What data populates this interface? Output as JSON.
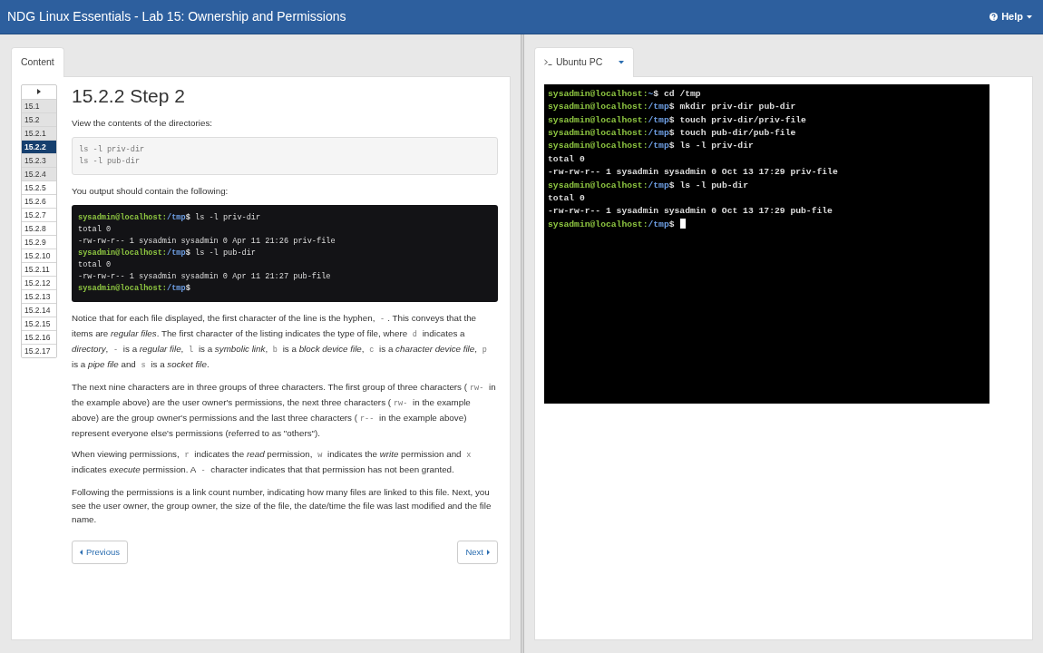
{
  "navbar": {
    "title": "NDG Linux Essentials - Lab 15: Ownership and Permissions",
    "help": "Help"
  },
  "left_tabs": [
    {
      "label": "Content",
      "selected": true
    }
  ],
  "step_nav": {
    "items": [
      {
        "label": "15.1",
        "selected": false,
        "visited": true
      },
      {
        "label": "15.2",
        "selected": false,
        "visited": true
      },
      {
        "label": "15.2.1",
        "selected": false,
        "visited": true
      },
      {
        "label": "15.2.2",
        "selected": true
      },
      {
        "label": "15.2.3",
        "selected": false,
        "visited": true
      },
      {
        "label": "15.2.4",
        "selected": false,
        "visited": true
      },
      {
        "label": "15.2.5",
        "selected": false,
        "visited": false
      },
      {
        "label": "15.2.6",
        "selected": false,
        "visited": false
      },
      {
        "label": "15.2.7",
        "selected": false,
        "visited": false
      },
      {
        "label": "15.2.8",
        "selected": false,
        "visited": false
      },
      {
        "label": "15.2.9",
        "selected": false,
        "visited": false
      },
      {
        "label": "15.2.10",
        "selected": false,
        "visited": false
      },
      {
        "label": "15.2.11",
        "selected": false,
        "visited": false
      },
      {
        "label": "15.2.12",
        "selected": false,
        "visited": false
      },
      {
        "label": "15.2.13",
        "selected": false,
        "visited": false
      },
      {
        "label": "15.2.14",
        "selected": false,
        "visited": false
      },
      {
        "label": "15.2.15",
        "selected": false,
        "visited": false
      },
      {
        "label": "15.2.16",
        "selected": false,
        "visited": false
      },
      {
        "label": "15.2.17",
        "selected": false,
        "visited": false
      }
    ]
  },
  "lesson": {
    "heading": "15.2.2 Step 2",
    "blocks": [
      {
        "kind": "paragraph",
        "segments": [
          {
            "kind": "text",
            "text": "View the contents of the directories:"
          }
        ]
      },
      {
        "kind": "command",
        "lines": [
          "ls -l priv-dir",
          "ls -l pub-dir"
        ]
      },
      {
        "kind": "paragraph",
        "segments": [
          {
            "kind": "text",
            "text": "You output should contain the following:"
          }
        ]
      },
      {
        "kind": "terminal",
        "lines": [
          {
            "kind": "prompt",
            "host": "sysadmin@localhost:",
            "path": "/tmp",
            "sign": "$",
            "command": " ls -l priv-dir"
          },
          {
            "kind": "output",
            "text": "total 0"
          },
          {
            "kind": "output",
            "text": "-rw-rw-r-- 1 sysadmin sysadmin 0 Apr 11 21:26 priv-file"
          },
          {
            "kind": "prompt",
            "host": "sysadmin@localhost:",
            "path": "/tmp",
            "sign": "$",
            "command": " ls -l pub-dir"
          },
          {
            "kind": "output",
            "text": "total 0"
          },
          {
            "kind": "output",
            "text": "-rw-rw-r-- 1 sysadmin sysadmin 0 Apr 11 21:27 pub-file"
          },
          {
            "kind": "prompt",
            "host": "sysadmin@localhost:",
            "path": "/tmp",
            "sign": "$"
          }
        ]
      },
      {
        "kind": "paragraph",
        "segments": [
          {
            "kind": "text",
            "text": "Notice that for each file displayed, the first character of the line is the hyphen, "
          },
          {
            "kind": "code",
            "text": "-"
          },
          {
            "kind": "text",
            "text": ". This conveys that the items are *regular files*. The first character of the listing indicates the type of file, where "
          },
          {
            "kind": "code",
            "text": "d"
          },
          {
            "kind": "text",
            "text": " indicates a *directory*, "
          },
          {
            "kind": "code",
            "text": "-"
          },
          {
            "kind": "text",
            "text": " is a *regular file*, "
          },
          {
            "kind": "code",
            "text": "l"
          },
          {
            "kind": "text",
            "text": " is a *symbolic link*, "
          },
          {
            "kind": "code",
            "text": "b"
          },
          {
            "kind": "text",
            "text": " is a *block device file*, "
          },
          {
            "kind": "code",
            "text": "c"
          },
          {
            "kind": "text",
            "text": " is a *character device file*, "
          },
          {
            "kind": "code",
            "text": "p"
          },
          {
            "kind": "text",
            "text": " is a *pipe file* and "
          },
          {
            "kind": "code",
            "text": "s"
          },
          {
            "kind": "text",
            "text": " is a *socket file*."
          }
        ]
      },
      {
        "kind": "paragraph",
        "segments": [
          {
            "kind": "text",
            "text": "The next nine characters are in three groups of three characters. The first group of three characters ("
          },
          {
            "kind": "code",
            "text": "rw-"
          },
          {
            "kind": "text",
            "text": " in the example above) are the user owner's permissions, the next three characters ("
          },
          {
            "kind": "code",
            "text": "rw-"
          },
          {
            "kind": "text",
            "text": " in the example above) are the group owner's permissions and the last three characters ("
          },
          {
            "kind": "code",
            "text": "r--"
          },
          {
            "kind": "text",
            "text": " in the example above) represent everyone else's permissions (referred to as \"others\")."
          }
        ]
      },
      {
        "kind": "paragraph",
        "segments": [
          {
            "kind": "text",
            "text": "When viewing permissions, "
          },
          {
            "kind": "code",
            "text": "r"
          },
          {
            "kind": "text",
            "text": " indicates the *read* permission, "
          },
          {
            "kind": "code",
            "text": "w"
          },
          {
            "kind": "text",
            "text": " indicates the *write* permission and "
          },
          {
            "kind": "code",
            "text": "x"
          },
          {
            "kind": "text",
            "text": " indicates *execute* permission. A "
          },
          {
            "kind": "code",
            "text": "-"
          },
          {
            "kind": "text",
            "text": " character indicates that that permission has not been granted."
          }
        ]
      },
      {
        "kind": "paragraph",
        "segments": [
          {
            "kind": "text",
            "text": "Following the permissions is a link count number, indicating how many files are linked to this file. Next, you see the user owner, the group owner, the size of the file, the date/time the file was last modified and the file name."
          }
        ]
      }
    ],
    "previous": "Previous",
    "next": "Next"
  },
  "right_tabs": [
    {
      "label": "Ubuntu PC",
      "selected": true
    }
  ],
  "terminal": {
    "lines": [
      {
        "kind": "prompt",
        "host": "sysadmin@localhost:",
        "path": "~",
        "sign": "$",
        "command": " cd /tmp"
      },
      {
        "kind": "prompt",
        "host": "sysadmin@localhost:",
        "path": "/tmp",
        "sign": "$",
        "command": " mkdir priv-dir pub-dir"
      },
      {
        "kind": "prompt",
        "host": "sysadmin@localhost:",
        "path": "/tmp",
        "sign": "$",
        "command": " touch priv-dir/priv-file"
      },
      {
        "kind": "prompt",
        "host": "sysadmin@localhost:",
        "path": "/tmp",
        "sign": "$",
        "command": " touch pub-dir/pub-file"
      },
      {
        "kind": "prompt",
        "host": "sysadmin@localhost:",
        "path": "/tmp",
        "sign": "$",
        "command": " ls -l priv-dir"
      },
      {
        "kind": "output",
        "text": "total 0"
      },
      {
        "kind": "output",
        "text": "-rw-rw-r-- 1 sysadmin sysadmin 0 Oct 13 17:29 priv-file"
      },
      {
        "kind": "prompt",
        "host": "sysadmin@localhost:",
        "path": "/tmp",
        "sign": "$",
        "command": " ls -l pub-dir"
      },
      {
        "kind": "output",
        "text": "total 0"
      },
      {
        "kind": "output",
        "text": "-rw-rw-r-- 1 sysadmin sysadmin 0 Oct 13 17:29 pub-file"
      },
      {
        "kind": "prompt",
        "host": "sysadmin@localhost:",
        "path": "/tmp",
        "sign": "$",
        "cursor": true
      }
    ]
  }
}
